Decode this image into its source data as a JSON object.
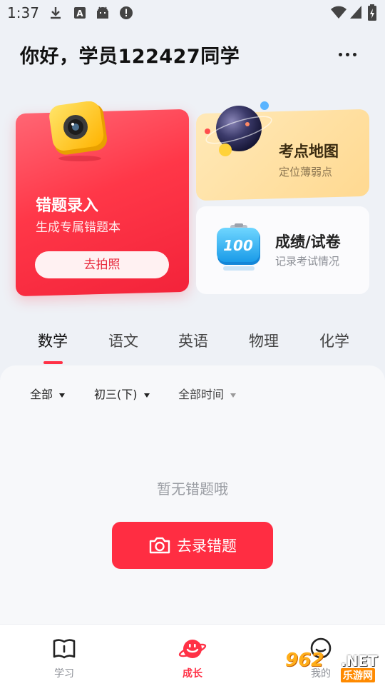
{
  "status_bar": {
    "time": "1:37",
    "left_icons": [
      "download-icon",
      "font-a-icon",
      "android-icon",
      "alert-icon"
    ],
    "right_icons": [
      "wifi-icon",
      "signal-icon",
      "battery-icon"
    ]
  },
  "header": {
    "greeting": "你好，学员122427同学",
    "more_icon": "more-dots-icon"
  },
  "cards": {
    "mistake_entry": {
      "title": "错题录入",
      "subtitle": "生成专属错题本",
      "button": "去拍照",
      "icon": "camera-3d-icon",
      "color": "#ff3748"
    },
    "knowledge_map": {
      "title": "考点地图",
      "subtitle": "定位薄弱点",
      "icon": "planet-icon",
      "color": "#ffd991"
    },
    "scores": {
      "title": "成绩/试卷",
      "subtitle": "记录考试情况",
      "icon": "score-100-icon",
      "icon_text": "100"
    }
  },
  "subject_tabs": {
    "items": [
      "数学",
      "语文",
      "英语",
      "物理",
      "化学"
    ],
    "active": "数学",
    "accent": "#ff3146"
  },
  "filters": {
    "scope": "全部",
    "grade": "初三(下)",
    "time": "全部时间"
  },
  "empty_state": {
    "message": "暂无错题哦",
    "button": "去录错题",
    "button_icon": "camera-icon"
  },
  "bottom_nav": {
    "items": [
      {
        "label": "学习",
        "icon": "book-icon"
      },
      {
        "label": "成长",
        "icon": "growth-planet-icon"
      },
      {
        "label": "我的",
        "icon": "profile-icon"
      }
    ],
    "active": "成长"
  },
  "watermark": {
    "main": "962",
    "net": ".NET",
    "sub": "乐游网"
  }
}
